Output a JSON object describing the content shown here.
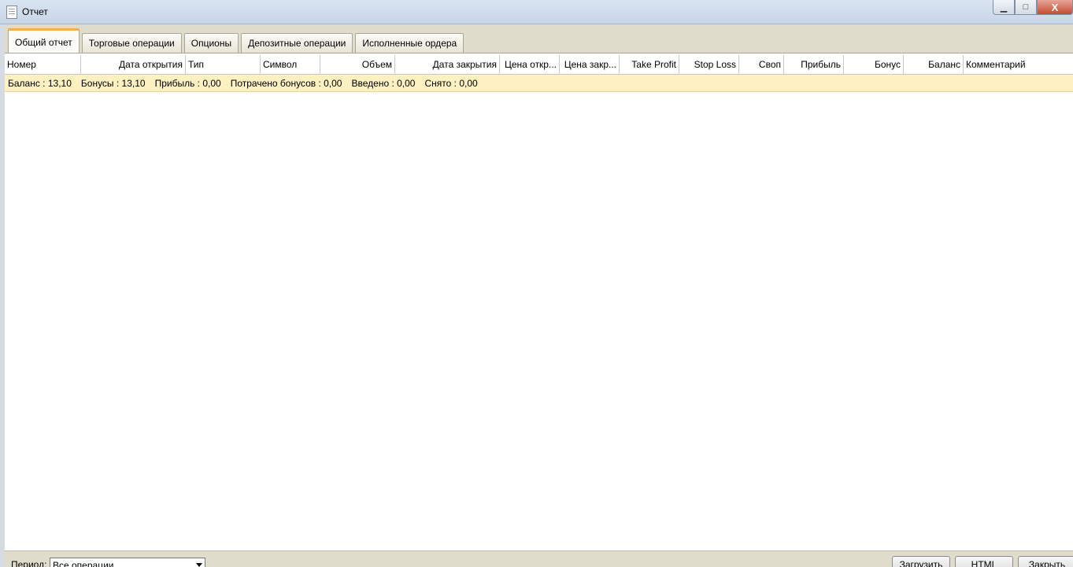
{
  "window": {
    "title": "Отчет"
  },
  "window_controls": {
    "minimize": "▁",
    "maximize": "□",
    "close": "X"
  },
  "tabs": [
    {
      "label": "Общий отчет",
      "active": true
    },
    {
      "label": "Торговые операции",
      "active": false
    },
    {
      "label": "Опционы",
      "active": false
    },
    {
      "label": "Депозитные операции",
      "active": false
    },
    {
      "label": "Исполненные ордера",
      "active": false
    }
  ],
  "table": {
    "columns": [
      "Номер",
      "Дата открытия",
      "Тип",
      "Символ",
      "Объем",
      "Дата закрытия",
      "Цена откр...",
      "Цена закр...",
      "Take Profit",
      "Stop Loss",
      "Своп",
      "Прибыль",
      "Бонус",
      "Баланс",
      "Комментарий"
    ],
    "summary": {
      "balance": "Баланс : 13,10",
      "bonuses": "Бонусы : 13,10",
      "profit": "Прибыль : 0,00",
      "spent_bonuses": "Потрачено бонусов : 0,00",
      "deposited": "Введено : 0,00",
      "withdrawn": "Снято : 0,00"
    }
  },
  "footer": {
    "period_label": "Период:",
    "period_value": "Все операции",
    "load_button": "Загрузить",
    "html_button": "HTML",
    "close_button": "Закрыть"
  },
  "colors": {
    "summary_bg": "#fdf0c1",
    "active_tab_accent": "#f0b24a",
    "close_button": "#c44b32"
  }
}
